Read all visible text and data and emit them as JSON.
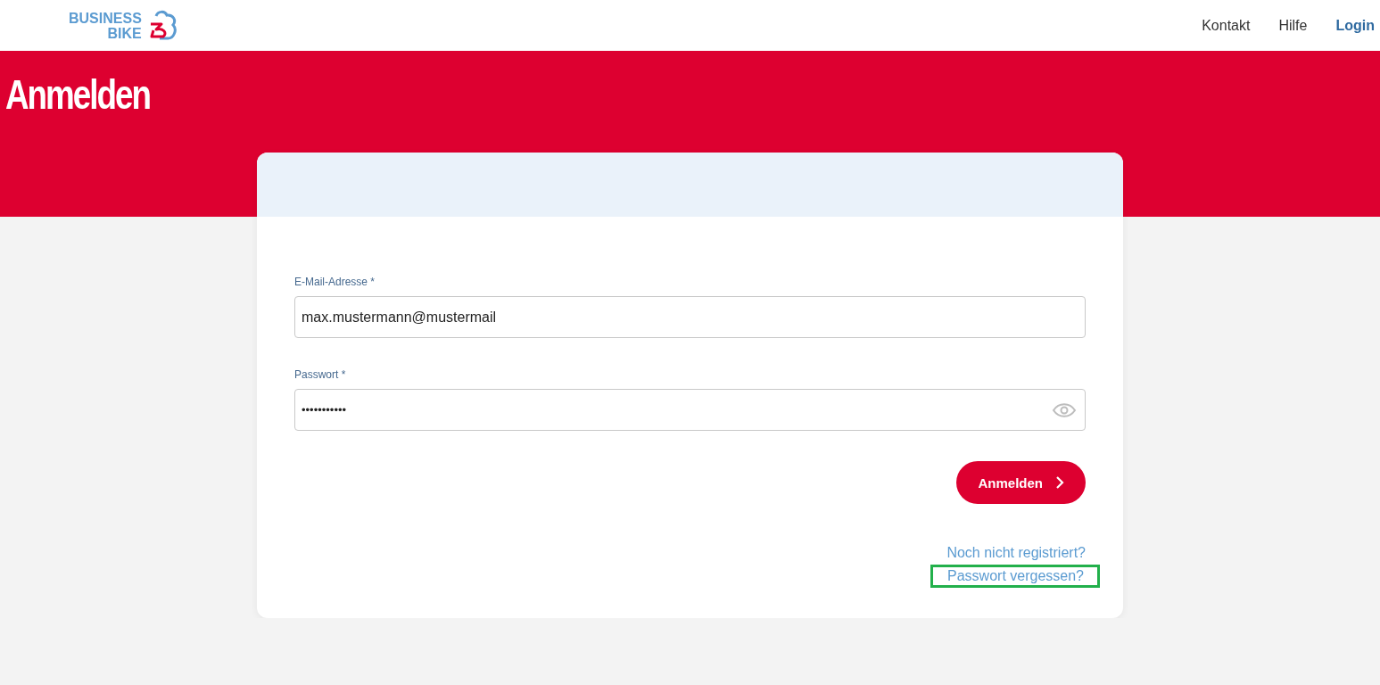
{
  "header": {
    "logo": {
      "line_1": "BUSINESS",
      "line_2": "BIKE"
    },
    "nav": [
      {
        "label": "Kontakt",
        "selected": false
      },
      {
        "label": "Hilfe",
        "selected": false
      },
      {
        "label": "Login",
        "selected": true
      }
    ]
  },
  "page_title": "Anmelden",
  "form": {
    "fields": [
      {
        "kind": "text",
        "label": "E-Mail-Adresse *",
        "value": "max.mustermann@mustermail"
      },
      {
        "kind": "password",
        "label": "Passwort *",
        "value": "•••••••••••"
      }
    ],
    "submit": {
      "label": "Anmelden"
    },
    "links": [
      {
        "label": "Noch nicht registriert?",
        "highlighted": false
      },
      {
        "label": "Passwort vergessen?",
        "highlighted": true
      }
    ]
  }
}
